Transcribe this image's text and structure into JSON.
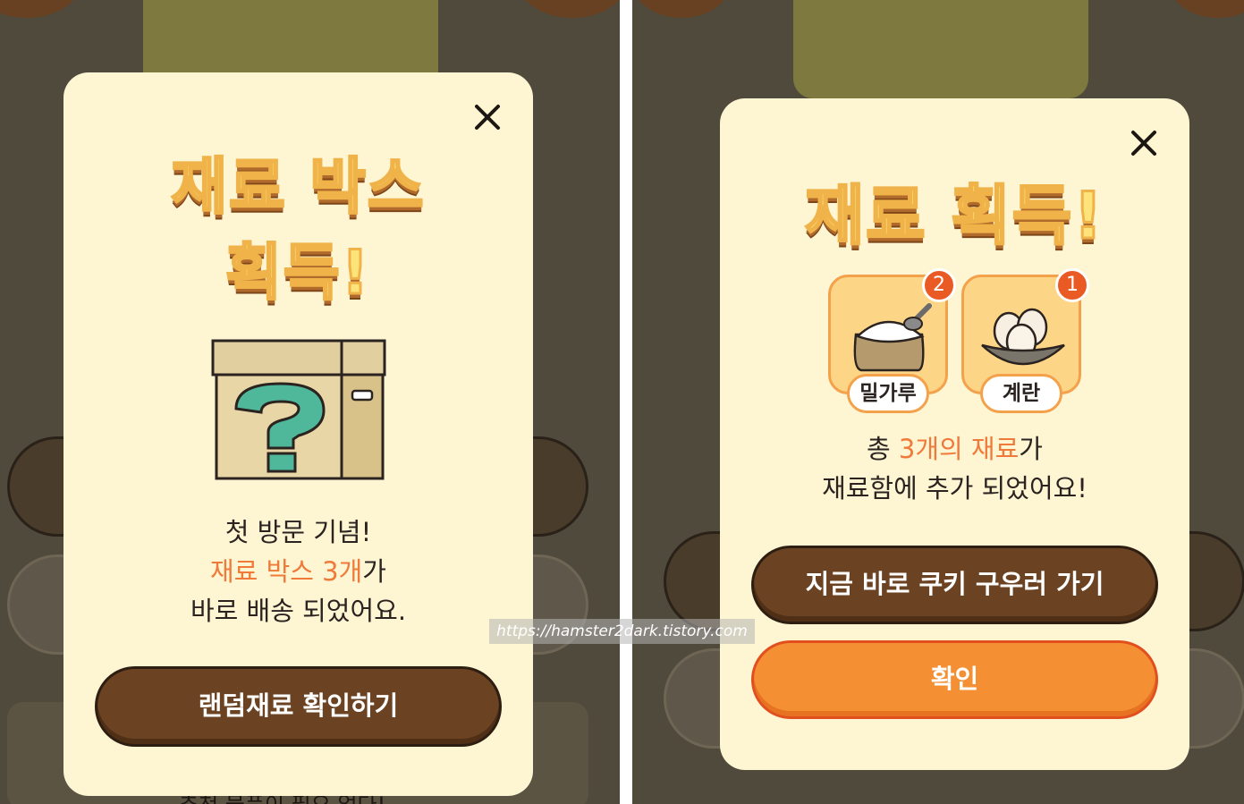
{
  "left_popup": {
    "title_line1": "재료 박스",
    "title_line2": "획득!",
    "message_line1": "첫 방문 기념!",
    "message_highlight": "재료 박스 3개",
    "message_highlight_suffix": "가",
    "message_line3": "바로 배송 되었어요.",
    "button_label": "랜덤재료 확인하기",
    "box_icon": "question-box-icon",
    "close_icon": "close-icon",
    "background_footer_text": "추천 물품이 필요 없다!"
  },
  "right_popup": {
    "title": "재료 획득!",
    "items": [
      {
        "name": "밀가루",
        "count": "2",
        "icon": "flour-sack-icon"
      },
      {
        "name": "계란",
        "count": "1",
        "icon": "eggs-bowl-icon"
      }
    ],
    "message_prefix": "총 ",
    "message_highlight": "3개의 재료",
    "message_suffix": "가",
    "message_line2": "재료함에 추가 되었어요!",
    "primary_button": "지금 바로 쿠키 구우러 가기",
    "confirm_button": "확인",
    "close_icon": "close-icon"
  },
  "watermark": "https://hamster2dark.tistory.com",
  "colors": {
    "overlay": "#504a3c",
    "modal_bg": "#fef5d3",
    "accent_orange": "#f07a3a",
    "button_brown": "#6b4322",
    "button_orange": "#f48f33",
    "badge_red": "#e95a25"
  }
}
